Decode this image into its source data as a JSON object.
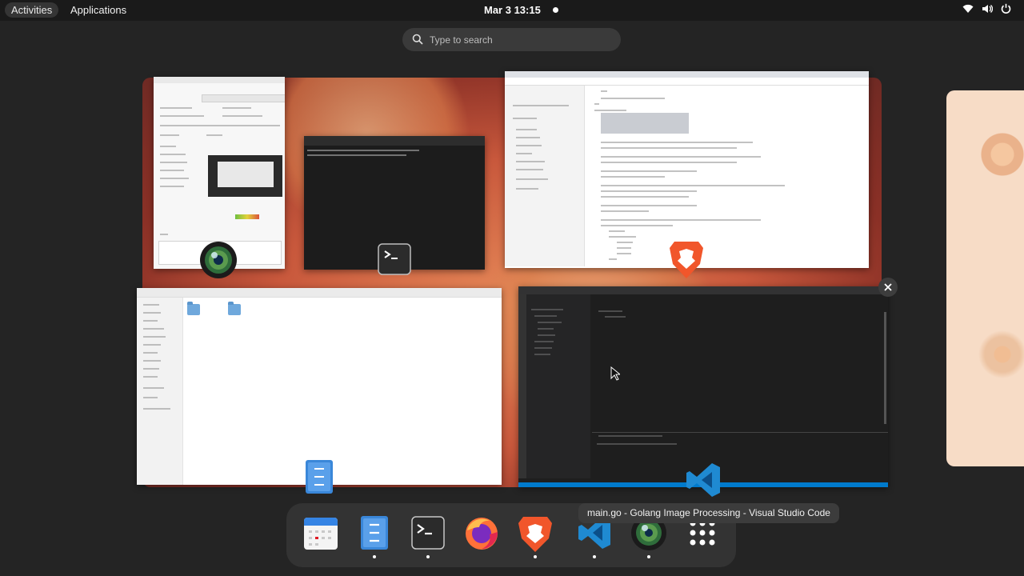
{
  "topbar": {
    "activities": "Activities",
    "applications": "Applications",
    "clock": "Mar 3  13:15",
    "status_icons": [
      "wifi-icon",
      "volume-icon",
      "power-icon"
    ]
  },
  "search": {
    "placeholder": "Type to search"
  },
  "windows": [
    {
      "name": "screen-recorder",
      "app": "camera-recorder"
    },
    {
      "name": "terminal",
      "app": "terminal"
    },
    {
      "name": "brave-browser",
      "app": "brave"
    },
    {
      "name": "files",
      "app": "files"
    },
    {
      "name": "vscode",
      "app": "visual-studio-code"
    }
  ],
  "dash": {
    "tooltip": "main.go - Golang Image Processing - Visual Studio Code",
    "apps": [
      {
        "id": "calendar",
        "running": false
      },
      {
        "id": "files",
        "running": true
      },
      {
        "id": "terminal",
        "running": true
      },
      {
        "id": "firefox",
        "running": false
      },
      {
        "id": "brave",
        "running": true
      },
      {
        "id": "vscode",
        "running": true
      },
      {
        "id": "camera-recorder",
        "running": true
      },
      {
        "id": "show-apps",
        "running": false
      }
    ]
  },
  "colors": {
    "panel": "#1a1a1a",
    "overview_bg": "#242424",
    "dash_bg": "#333333",
    "vscode_blue": "#007acc",
    "brave_orange": "#f1562b"
  }
}
